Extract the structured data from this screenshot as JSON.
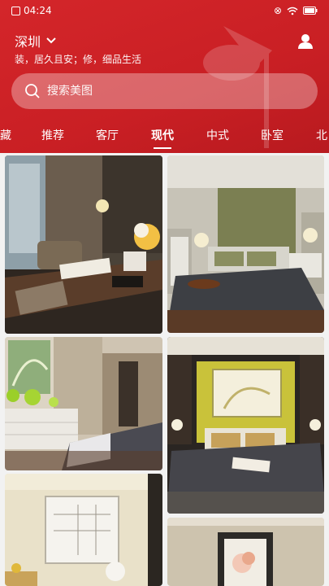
{
  "status_bar": {
    "time": "04:24"
  },
  "header": {
    "city": "深圳",
    "slogan": "装，居久且安；修，细品生活"
  },
  "search": {
    "placeholder": "搜索美图"
  },
  "tabs": [
    "藏",
    "推荐",
    "客厅",
    "现代",
    "中式",
    "卧室",
    "北"
  ],
  "active_tab": "现代",
  "colors": {
    "brand": "#c91f24",
    "background": "#f2f2f2"
  },
  "images": [
    {
      "subject": "study-room"
    },
    {
      "subject": "bedroom-green-headboard"
    },
    {
      "subject": "bedroom-dresser"
    },
    {
      "subject": "bedroom-yellow-wall"
    },
    {
      "subject": "framed-floor-plan"
    },
    {
      "subject": "framed-flower-art"
    }
  ]
}
